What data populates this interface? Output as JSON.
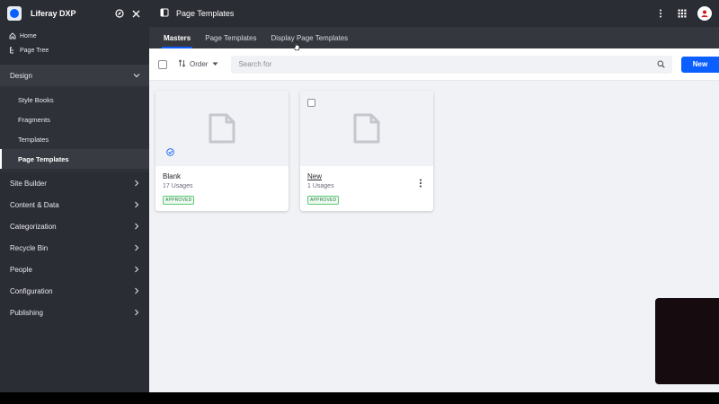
{
  "sidebar": {
    "app_title": "Liferay DXP",
    "quick_links": [
      {
        "label": "Home",
        "icon": "home-icon"
      },
      {
        "label": "Page Tree",
        "icon": "page-tree-icon"
      }
    ],
    "design": {
      "label": "Design",
      "items": [
        "Style Books",
        "Fragments",
        "Templates",
        "Page Templates"
      ],
      "active": "Page Templates"
    },
    "sections": [
      "Site Builder",
      "Content & Data",
      "Categorization",
      "Recycle Bin",
      "People",
      "Configuration",
      "Publishing"
    ]
  },
  "header": {
    "title": "Page Templates"
  },
  "tabs": [
    {
      "label": "Masters",
      "active": true
    },
    {
      "label": "Page Templates",
      "active": false
    },
    {
      "label": "Display Page Templates",
      "active": false
    }
  ],
  "toolbar": {
    "order_label": "Order",
    "search_placeholder": "Search for",
    "new_label": "New"
  },
  "cards": [
    {
      "name": "Blank",
      "usages": "17 Usages",
      "status": "APPROVED"
    },
    {
      "name": "New",
      "usages": "1 Usages",
      "status": "APPROVED"
    }
  ],
  "colors": {
    "primary": "#0b5fff",
    "sidebar_bg": "#2b2d34",
    "success": "#287d3c"
  }
}
